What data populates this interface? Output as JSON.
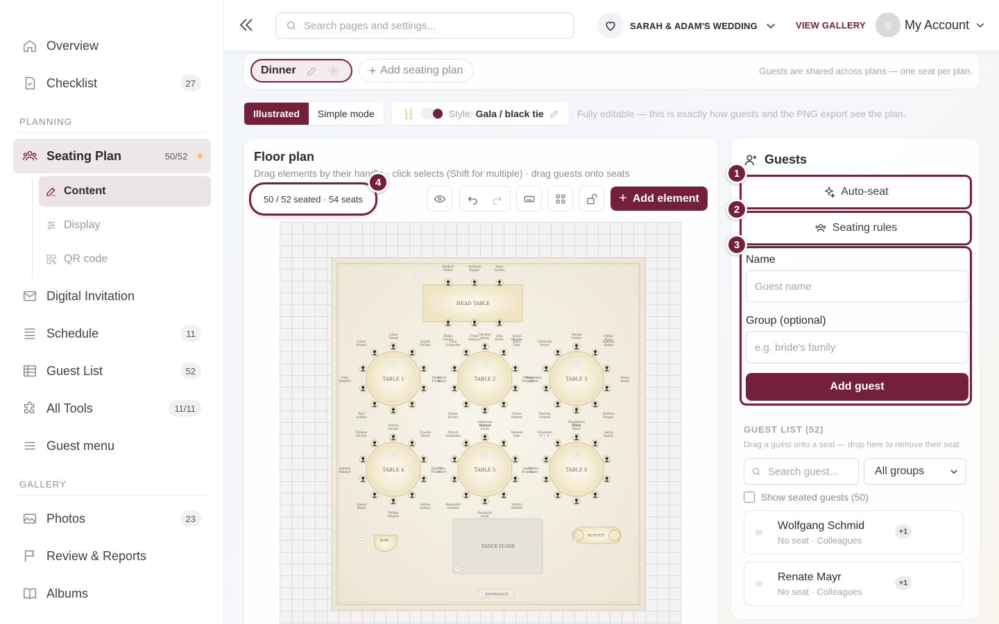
{
  "sidebar": {
    "items": [
      {
        "label": "Overview",
        "count": ""
      },
      {
        "label": "Checklist",
        "count": "27"
      },
      {
        "label": "Seating Plan",
        "count": "50/52"
      },
      {
        "label": "Digital Invitation",
        "count": ""
      },
      {
        "label": "Schedule",
        "count": "11"
      },
      {
        "label": "Guest List",
        "count": "52"
      },
      {
        "label": "All Tools",
        "count": "11/11"
      },
      {
        "label": "Guest menu",
        "count": ""
      },
      {
        "label": "Photos",
        "count": "23"
      },
      {
        "label": "Review & Reports",
        "count": ""
      },
      {
        "label": "Albums",
        "count": ""
      }
    ],
    "section_planning": "PLANNING",
    "section_gallery": "GALLERY",
    "sub_items": [
      {
        "label": "Content"
      },
      {
        "label": "Display"
      },
      {
        "label": "QR code"
      }
    ]
  },
  "topbar": {
    "search_placeholder": "Search pages and settings...",
    "wedding_name": "SARAH & ADAM'S WEDDING",
    "view_gallery": "VIEW GALLERY",
    "avatar_initial": "S",
    "account_label": "My Account"
  },
  "plans": {
    "active_plan": "Dinner",
    "add_plan_label": "Add seating plan",
    "note": "Guests are shared across plans — one seat per plan."
  },
  "mode": {
    "illustrated": "Illustrated",
    "simple": "Simple mode",
    "style_label": "Style:",
    "style_value": "Gala / black tie",
    "note": "Fully editable — this is exactly how guests and the PNG export see the plan."
  },
  "floor": {
    "title": "Floor plan",
    "subtitle": "Drag elements by their handle · click selects (Shift for multiple) · drag guests onto seats",
    "seated_summary": "50 / 52 seated · 54 seats",
    "add_element": "Add element",
    "badge_4": "4"
  },
  "floorplan": {
    "head_table": "HEAD TABLE",
    "dance_floor": "DANCE FLOOR",
    "bar": "BAR",
    "buffet": "BUFFET",
    "entrance": "ENTRANCE",
    "head_guests": [
      "Herbert Müller",
      "Gerlinde Berger",
      "Anna Gruber",
      "Helga Gruber",
      "Franz Schwarz",
      "Julia Hofer"
    ],
    "tables": [
      {
        "label": "TABLE 1",
        "guests": [
          "Lukas Mosel",
          "Sophie Fischer",
          "Laura Steiner",
          "Felix Wimmer",
          "Marie Weber",
          "Paul Leitner"
        ]
      },
      {
        "label": "TABLE 2",
        "guests": [
          "Michael Maier",
          "Jonas Eder",
          "Lena Schneider",
          "Elena Fuchs",
          "Maximilian Huber",
          "Simon Pichler",
          "Emma Wagner",
          "Katharina Schmidt",
          "David Winkler"
        ]
      },
      {
        "label": "TABLE 3",
        "guests": [
          "Martin Gruber",
          "Hannah Huber",
          "Christoph Mayer",
          "Verena Schwarz",
          "Tobias Bauer",
          "Theresa Schmid",
          "Andreas Berger",
          "Magdalena Müller",
          "Stefan Mayr"
        ]
      },
      {
        "label": "TABLE 4",
        "guests": [
          "Florian Steiner",
          "Claudia Moser",
          "Thomas Fischer",
          "Isabella Wimmer",
          "Nina Rotter",
          "Daniel Weber",
          "Sabine Leitner",
          "Philipp Wagner"
        ]
      },
      {
        "label": "TABLE 5",
        "guests": [
          "Markus Fuchs",
          "Melanie Eder",
          "Patrick Schneider",
          "Bianca Pichler",
          "Carina Bauer",
          "Alexander Schmidt",
          "Sandra Winkler",
          "Bernhard Hofer"
        ]
      },
      {
        "label": "TABLE 6",
        "guests": [
          "Petra Maier",
          "Georg Huber",
          "Elisabeth Mayer",
          "Sophie Brunner"
        ]
      }
    ]
  },
  "guests_panel": {
    "title": "Guests",
    "auto_seat": "Auto-seat",
    "seating_rules": "Seating rules",
    "name_label": "Name",
    "name_placeholder": "Guest name",
    "group_label": "Group (optional)",
    "group_placeholder": "e.g. bride's family",
    "add_guest": "Add guest",
    "list_header": "GUEST LIST (52)",
    "list_note": "Drag a guest onto a seat — drop here to remove their seat",
    "search_placeholder": "Search guest...",
    "group_filter": "All groups",
    "show_seated": "Show seated guests (50)",
    "badges": [
      "1",
      "2",
      "3"
    ],
    "guests": [
      {
        "name": "Wolfgang Schmid",
        "status": "No seat · Colleagues",
        "plus": "+1"
      },
      {
        "name": "Renate Mayr",
        "status": "No seat · Colleagues",
        "plus": "+1"
      }
    ]
  },
  "colors": {
    "accent": "#74203b",
    "star": "#f2c231"
  }
}
